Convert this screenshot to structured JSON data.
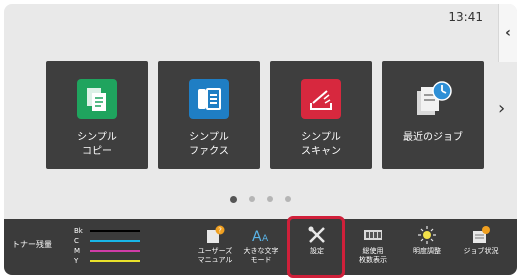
{
  "status": {
    "time": "13:41",
    "collapse_glyph": "‹"
  },
  "tiles": [
    {
      "label": "シンプル\nコピー",
      "icon": "copy-icon",
      "color": "#1fa45e"
    },
    {
      "label": "シンプル\nファクス",
      "icon": "fax-icon",
      "color": "#1f7ec4"
    },
    {
      "label": "シンプル\nスキャン",
      "icon": "scan-icon",
      "color": "#d7283e"
    },
    {
      "label": "最近のジョブ",
      "icon": "recent-jobs-icon",
      "color": "#5a5a5a"
    }
  ],
  "next_glyph": "›",
  "pager": {
    "pages": 4,
    "active": 0
  },
  "toner": {
    "label": "トナー残量",
    "levels": [
      {
        "letter": "Bk",
        "color": "#000000"
      },
      {
        "letter": "C",
        "color": "#18b6e6"
      },
      {
        "letter": "M",
        "color": "#d13ca8"
      },
      {
        "letter": "Y",
        "color": "#e9e12b"
      }
    ]
  },
  "bottom_buttons": [
    {
      "label": "ユーザーズ\nマニュアル",
      "icon": "manual-icon"
    },
    {
      "label": "大きな文字\nモード",
      "icon": "large-text-icon"
    },
    {
      "label": "設定",
      "icon": "settings-tools-icon"
    },
    {
      "label": "総使用\n枚数表示",
      "icon": "counter-icon"
    },
    {
      "label": "明度調整",
      "icon": "brightness-icon"
    },
    {
      "label": "ジョブ状況",
      "icon": "job-status-icon"
    }
  ],
  "colors": {
    "highlight": "#d0203a",
    "bar_bg": "#3b3b3b",
    "tile_bg": "#3e3e3e"
  }
}
